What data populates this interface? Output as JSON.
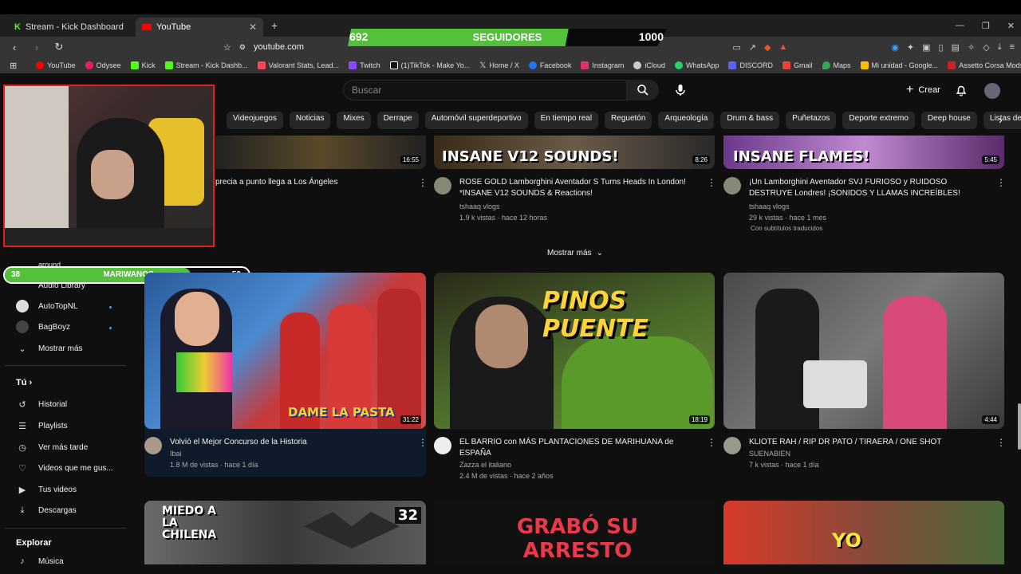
{
  "tabs": [
    {
      "label": "Stream - Kick Dashboard",
      "active": false
    },
    {
      "label": "YouTube",
      "active": true
    }
  ],
  "address_bar": {
    "url": "youtube.com"
  },
  "bookmarks": [
    {
      "label": "YouTube",
      "color": "#ff0000"
    },
    {
      "label": "Odysee",
      "color": "#ef1970"
    },
    {
      "label": "Kick",
      "color": "#53fc18"
    },
    {
      "label": "Stream - Kick Dashb...",
      "color": "#53fc18"
    },
    {
      "label": "Valorant Stats, Lead...",
      "color": "#ff4655"
    },
    {
      "label": "Twitch",
      "color": "#9146ff"
    },
    {
      "label": "(1)TikTok - Make Yo...",
      "color": "#ffffff"
    },
    {
      "label": "Home / X",
      "color": "#ffffff"
    },
    {
      "label": "Facebook",
      "color": "#1877f2"
    },
    {
      "label": "Instagram",
      "color": "#e1306c"
    },
    {
      "label": "iCloud",
      "color": "#cccccc"
    },
    {
      "label": "WhatsApp",
      "color": "#25d366"
    },
    {
      "label": "DISCORD",
      "color": "#5865f2"
    },
    {
      "label": "Gmail",
      "color": "#ea4335"
    },
    {
      "label": "Maps",
      "color": "#34a853"
    },
    {
      "label": "Mi unidad - Google...",
      "color": "#fbbc04"
    },
    {
      "label": "Assetto Corsa Mods...",
      "color": "#cc2222"
    }
  ],
  "followers_goal": {
    "current": "692",
    "title": "SEGUIDORES",
    "goal": "1000",
    "progress": 0.692
  },
  "subs_goal": {
    "current": "38",
    "title": "MARIWANOS",
    "goal": "50",
    "progress": 0.76
  },
  "youtube": {
    "search_placeholder": "Buscar",
    "create_label": "Crear"
  },
  "chips": [
    "Videojuegos",
    "Noticias",
    "Mixes",
    "Derrape",
    "Automóvil superdeportivo",
    "En tiempo real",
    "Reguetón",
    "Arqueología",
    "Drum & bass",
    "Puñetazos",
    "Deporte extremo",
    "Deep house",
    "Listas de re"
  ],
  "sidebar": {
    "partial_top": "around",
    "partial_lib": "Audio Library",
    "channels": [
      {
        "label": "AutoTopNL"
      },
      {
        "label": "BagBoyz"
      }
    ],
    "show_more": "Mostrar más",
    "you_heading": "Tú",
    "you_items": [
      {
        "label": "Historial",
        "icon": "history-icon",
        "glyph": "↺"
      },
      {
        "label": "Playlists",
        "icon": "playlist-icon",
        "glyph": "☰"
      },
      {
        "label": "Ver más tarde",
        "icon": "clock-icon",
        "glyph": "◷"
      },
      {
        "label": "Videos que me gus...",
        "icon": "thumb-up-icon",
        "glyph": "👍"
      },
      {
        "label": "Tus videos",
        "icon": "video-icon",
        "glyph": "▶"
      },
      {
        "label": "Descargas",
        "icon": "download-icon",
        "glyph": "⤓"
      }
    ],
    "explore_heading": "Explorar",
    "explore_items": [
      {
        "label": "Música"
      }
    ]
  },
  "row1": [
    {
      "title": "precia a punto llega a Los Ángeles",
      "channel": "",
      "meta": "",
      "duration": "16:55"
    },
    {
      "title": "ROSE GOLD Lamborghini Aventador S Turns Heads In London! *INSANE V12 SOUNDS & Reactions!",
      "channel": "tshaaq vlogs",
      "meta": "1.9 k vistas · hace 12 horas",
      "duration": "8:26",
      "thumb_text": "INSANE V12 SOUNDS!"
    },
    {
      "title": "¡Un Lamborghini Aventador SVJ FURIOSO y RUIDOSO DESTRUYE Londres! ¡SONIDOS Y LLAMAS INCREÍBLES!",
      "channel": "tshaaq vlogs",
      "meta": "29 k vistas · hace 1 mes",
      "extra": "Con subtítulos traducidos",
      "duration": "5:45",
      "thumb_text": "INSANE FLAMES!"
    }
  ],
  "show_more_label": "Mostrar más",
  "row2": [
    {
      "title": "Volvió el Mejor Concurso de la Historia",
      "channel": "Ibai",
      "meta": "1.8 M de vistas · hace 1 día",
      "duration": "31:22",
      "thumb_text": "DAME LA PASTA"
    },
    {
      "title": "EL BARRIO con MÁS PLANTACIONES DE MARIHUANA de ESPAÑA",
      "channel": "Zazza el italiano",
      "meta": "2.4 M de vistas · hace 2 años",
      "duration": "18:19",
      "thumb_text": "PINOS PUENTE"
    },
    {
      "title": "KLIOTE RAH / RIP DR PATO / TIRAERA / ONE SHOT",
      "channel": "SUENABIEN",
      "meta": "7 k vistas · hace 1 día",
      "duration": "4:44"
    }
  ],
  "row3": [
    {
      "thumb_text": "MIEDO A LA CHILENA",
      "badge": "32"
    },
    {
      "thumb_text": "GRABÓ SU ARRESTO"
    },
    {
      "thumb_text": "YO"
    }
  ]
}
